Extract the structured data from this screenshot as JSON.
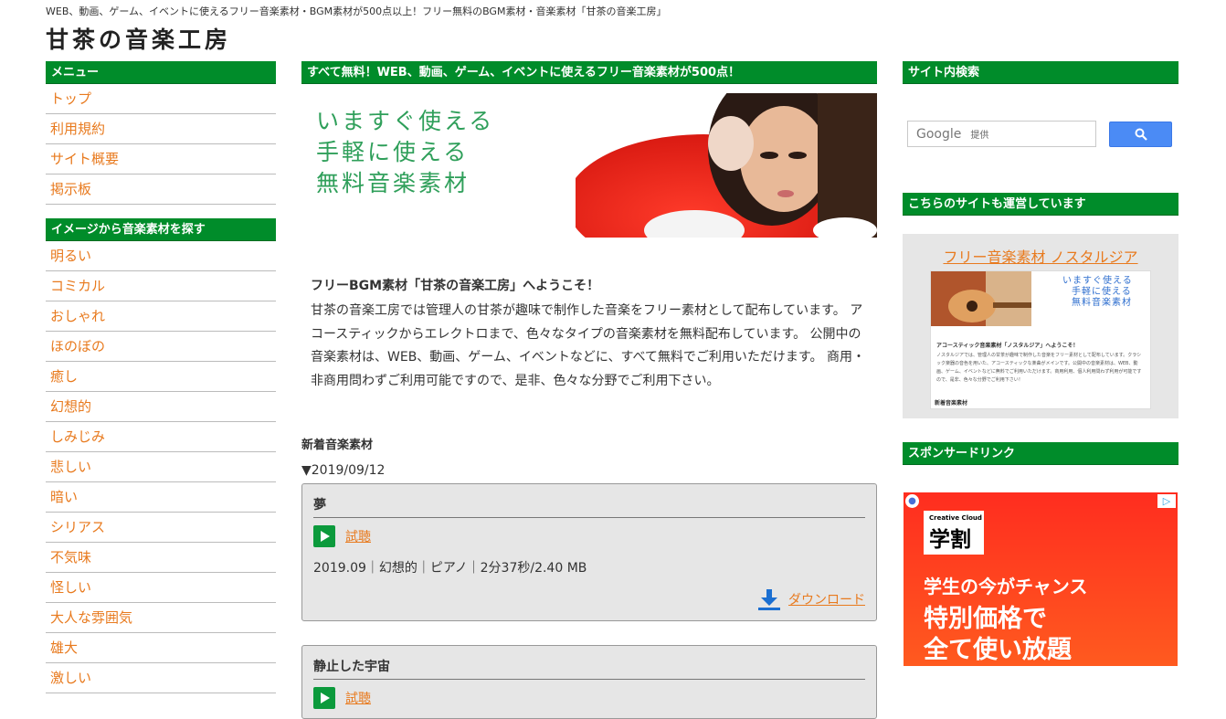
{
  "header": {
    "tagline": "WEB、動画、ゲーム、イベントに使えるフリー音楽素材・BGM素材が500点以上！フリー無料のBGM素材・音楽素材「甘茶の音楽工房」",
    "title": "甘茶の音楽工房"
  },
  "left": {
    "menu_heading": "メニュー",
    "menu_items": [
      "トップ",
      "利用規約",
      "サイト概要",
      "掲示板"
    ],
    "image_heading": "イメージから音楽素材を探す",
    "image_items": [
      "明るい",
      "コミカル",
      "おしゃれ",
      "ほのぼの",
      "癒し",
      "幻想的",
      "しみじみ",
      "悲しい",
      "暗い",
      "シリアス",
      "不気味",
      "怪しい",
      "大人な雰囲気",
      "雄大",
      "激しい"
    ]
  },
  "main": {
    "banner_heading": "すべて無料！WEB、動画、ゲーム、イベントに使えるフリー音楽素材が500点！",
    "hero_lines": [
      "いますぐ使える",
      "手軽に使える",
      "無料音楽素材"
    ],
    "welcome_title": "フリーBGM素材「甘茶の音楽工房」へようこそ！",
    "welcome_body": "甘茶の音楽工房では管理人の甘茶が趣味で制作した音楽をフリー素材として配布しています。 アコースティックからエレクトロまで、色々なタイプの音楽素材を無料配布しています。 公開中の音楽素材は、WEB、動画、ゲーム、イベントなどに、すべて無料でご利用いただけます。 商用・非商用問わずご利用可能ですので、是非、色々な分野でご利用下さい。",
    "new_heading": "新着音楽素材",
    "date": "▼2019/09/12",
    "tracks": [
      {
        "name": "夢",
        "listen": "試聴",
        "meta": "2019.09｜幻想的｜ピアノ｜2分37秒/2.40 MB",
        "download": "ダウンロード"
      },
      {
        "name": "静止した宇宙",
        "listen": "試聴"
      }
    ]
  },
  "right": {
    "search_heading": "サイト内検索",
    "search_logo": "Google",
    "search_placeholder": "提供",
    "sister_heading": "こちらのサイトも運営しています",
    "sister_link": "フリー音楽素材 ノスタルジア",
    "sister_thumb_lines": [
      "いますぐ使える",
      "手軽に使える",
      "無料音楽素材"
    ],
    "sister_thumb_welcome": "アコースティック音楽素材「ノスタルジア」へようこそ！",
    "sister_thumb_body": "ノスタルジアでは、管理人の甘茶が趣味で制作した音楽をフリー素材として配布しています。クラシック楽器の音色を用いた、アコースティックな楽曲がメインです。公開中の音楽素材は、WEB、動画、ゲーム、イベントなどに無料でご利用いただけます。商用利用、個人利用問わず利用が可能ですので、是非、色々な分野でご利用下さい！",
    "sister_thumb_new": "新着音楽素材",
    "sponsor_heading": "スポンサードリンク",
    "ad": {
      "badge_small": "Creative Cloud",
      "badge_big": "学割",
      "line1": "学生の今がチャンス",
      "line2": "特別価格で",
      "line3": "全て使い放題"
    }
  },
  "colors": {
    "accent_green": "#008c2a",
    "link_orange": "#e87a1e",
    "panel_gray": "#e6e6e6"
  }
}
